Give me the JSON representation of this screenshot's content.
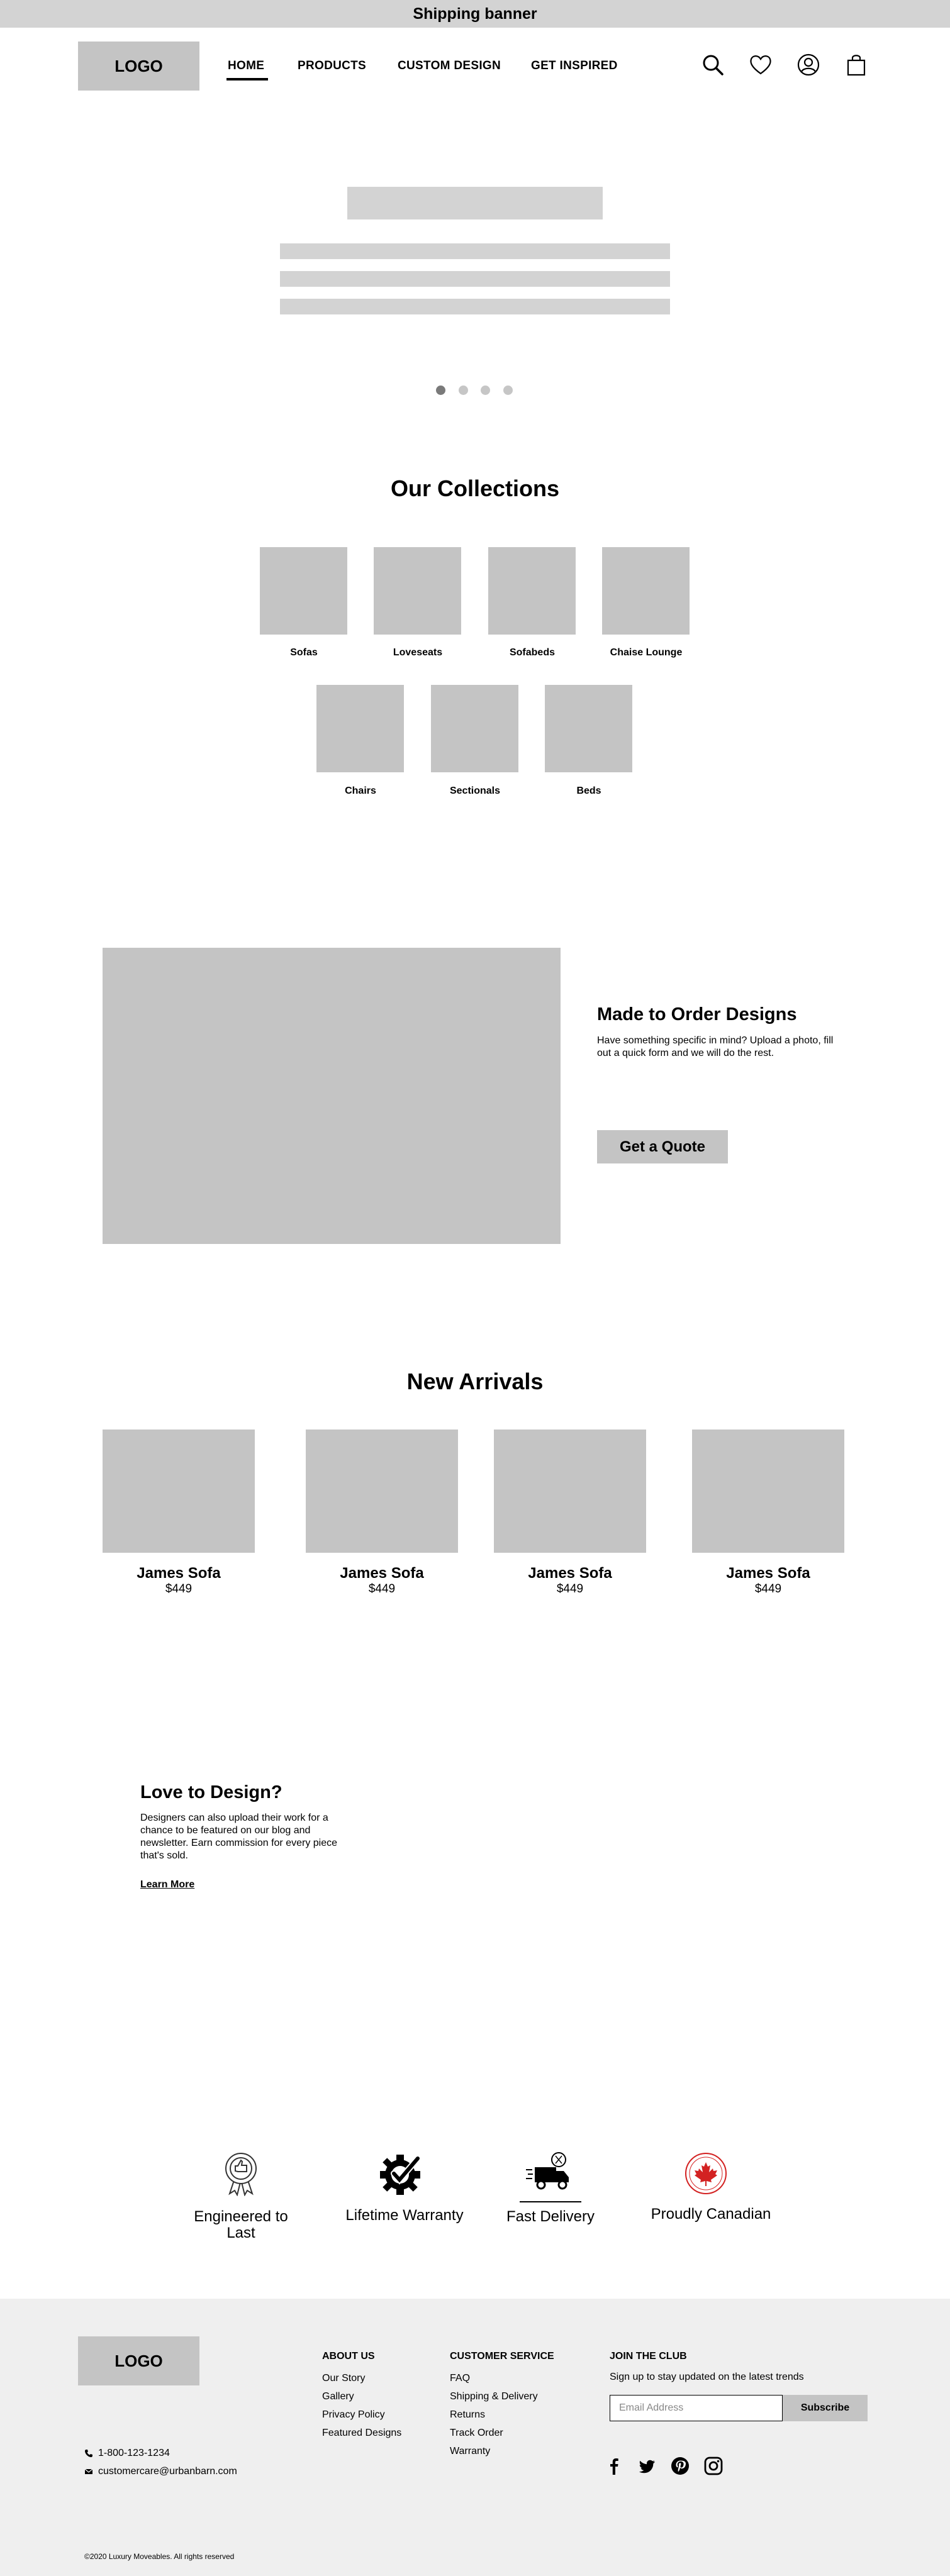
{
  "banner": {
    "text": "Shipping banner"
  },
  "header": {
    "logo": "LOGO",
    "nav": [
      {
        "label": "HOME",
        "active": true
      },
      {
        "label": "PRODUCTS"
      },
      {
        "label": "CUSTOM DESIGN"
      },
      {
        "label": "GET INSPIRED"
      }
    ],
    "icons": [
      "search-icon",
      "heart-icon",
      "account-icon",
      "cart-icon"
    ]
  },
  "hero": {
    "slide_count": 4,
    "active_slide": 1
  },
  "collections": {
    "title": "Our Collections",
    "items": [
      {
        "label": "Sofas"
      },
      {
        "label": "Loveseats"
      },
      {
        "label": "Sofabeds"
      },
      {
        "label": "Chaise Lounge"
      },
      {
        "label": "Chairs"
      },
      {
        "label": "Sectionals"
      },
      {
        "label": "Beds"
      }
    ]
  },
  "made_to_order": {
    "title": "Made to Order Designs",
    "text": "Have something specific in mind? Upload a photo, fill out a quick form and we will do the rest.",
    "button": "Get a Quote"
  },
  "new_arrivals": {
    "title": "New Arrivals",
    "products": [
      {
        "name": "James Sofa",
        "price": "$449"
      },
      {
        "name": "James Sofa",
        "price": "$449"
      },
      {
        "name": "James Sofa",
        "price": "$449"
      },
      {
        "name": "James Sofa",
        "price": "$449"
      }
    ]
  },
  "love_to_design": {
    "title": "Love to Design?",
    "text": "Designers can also upload their work for a chance to be featured on our blog and newsletter. Earn commission for every piece that's sold.",
    "link": "Learn More"
  },
  "features": [
    {
      "icon": "award-ribbon-icon",
      "label": "Engineered to Last"
    },
    {
      "icon": "gear-check-icon",
      "label": "Lifetime Warranty"
    },
    {
      "icon": "delivery-truck-icon",
      "label": "Fast Delivery"
    },
    {
      "icon": "maple-leaf-icon",
      "label": "Proudly Canadian"
    }
  ],
  "footer": {
    "logo": "LOGO",
    "contact": {
      "phone": "1-800-123-1234",
      "email": "customercare@urbanbarn.com"
    },
    "about": {
      "heading": "ABOUT US",
      "links": [
        "Our Story",
        "Gallery",
        "Privacy Policy",
        "Featured Designs"
      ]
    },
    "customer_service": {
      "heading": "CUSTOMER SERVICE",
      "links": [
        "FAQ",
        "Shipping & Delivery",
        "Returns",
        "Track Order",
        "Warranty"
      ]
    },
    "club": {
      "heading": "JOIN THE CLUB",
      "text": "Sign up to stay updated on the latest trends",
      "email_placeholder": "Email Address",
      "button": "Subscribe"
    },
    "social": [
      "facebook-icon",
      "twitter-icon",
      "pinterest-icon",
      "instagram-icon"
    ],
    "copyright": "©2020 Luxury Moveables. All rights reserved"
  }
}
